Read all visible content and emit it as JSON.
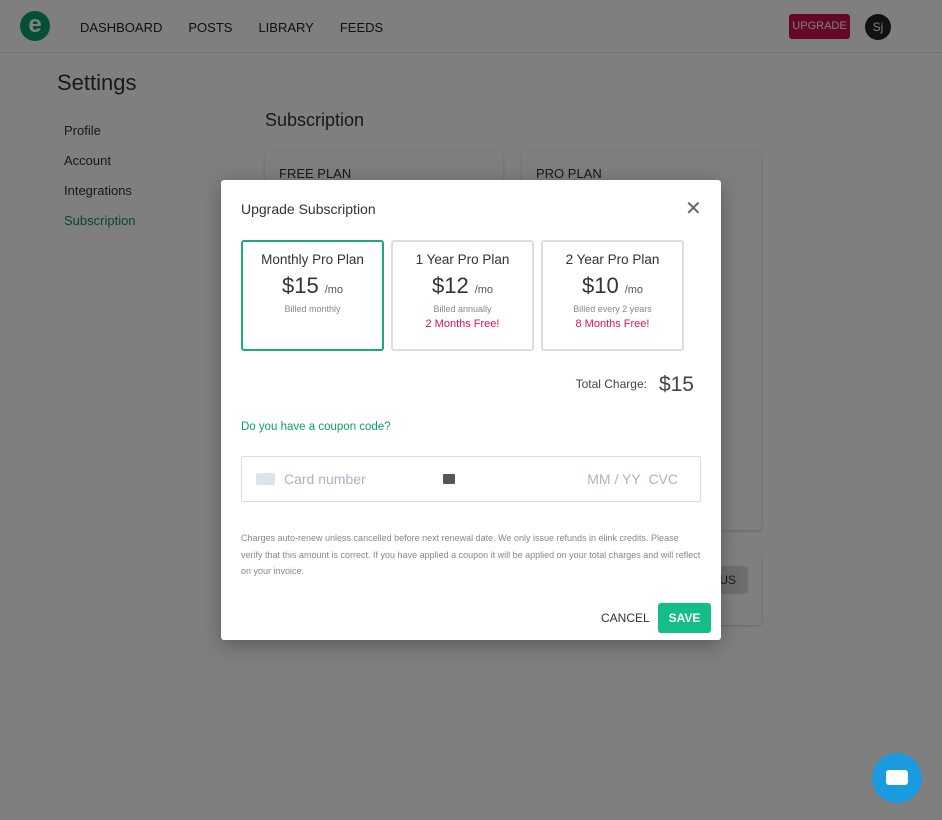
{
  "nav": {
    "logo": "e",
    "links": [
      "DASHBOARD",
      "POSTS",
      "LIBRARY",
      "FEEDS"
    ],
    "upgrade": "UPGRADE",
    "avatar": "Sj"
  },
  "settings": {
    "title": "Settings",
    "sidebar": [
      "Profile",
      "Account",
      "Integrations",
      "Subscription"
    ],
    "active": "Subscription",
    "section_title": "Subscription",
    "free_plan": "FREE PLAN",
    "pro_plan": "PRO PLAN",
    "partial_button": "US"
  },
  "modal": {
    "title": "Upgrade Subscription",
    "plans": [
      {
        "name": "Monthly Pro Plan",
        "price": "$15",
        "unit": "/mo",
        "billing": "Billed monthly",
        "free": "",
        "selected": true
      },
      {
        "name": "1 Year Pro Plan",
        "price": "$12",
        "unit": "/mo",
        "billing": "Billed annually",
        "free": "2 Months Free!",
        "selected": false
      },
      {
        "name": "2 Year Pro Plan",
        "price": "$10",
        "unit": "/mo",
        "billing": "Billed every 2 years",
        "free": "8 Months Free!",
        "selected": false
      }
    ],
    "total_label": "Total Charge:",
    "total_value": "$15",
    "coupon": "Do you have a coupon code?",
    "card_placeholder": "Card number",
    "expiry_placeholder": "MM / YY",
    "cvc_placeholder": "CVC",
    "fine_print": "Charges auto-renew unless cancelled before next renewal date. We only issue refunds in elink credits. Please verify that this amount is correct. If you have applied a coupon it will be applied on your total charges and will reflect on your invoice.",
    "cancel": "CANCEL",
    "save": "SAVE"
  },
  "colors": {
    "brand": "#0f9d6e",
    "upgrade": "#c8104a",
    "save": "#13bf86",
    "promo": "#e0105a",
    "chat": "#1a9be0"
  }
}
